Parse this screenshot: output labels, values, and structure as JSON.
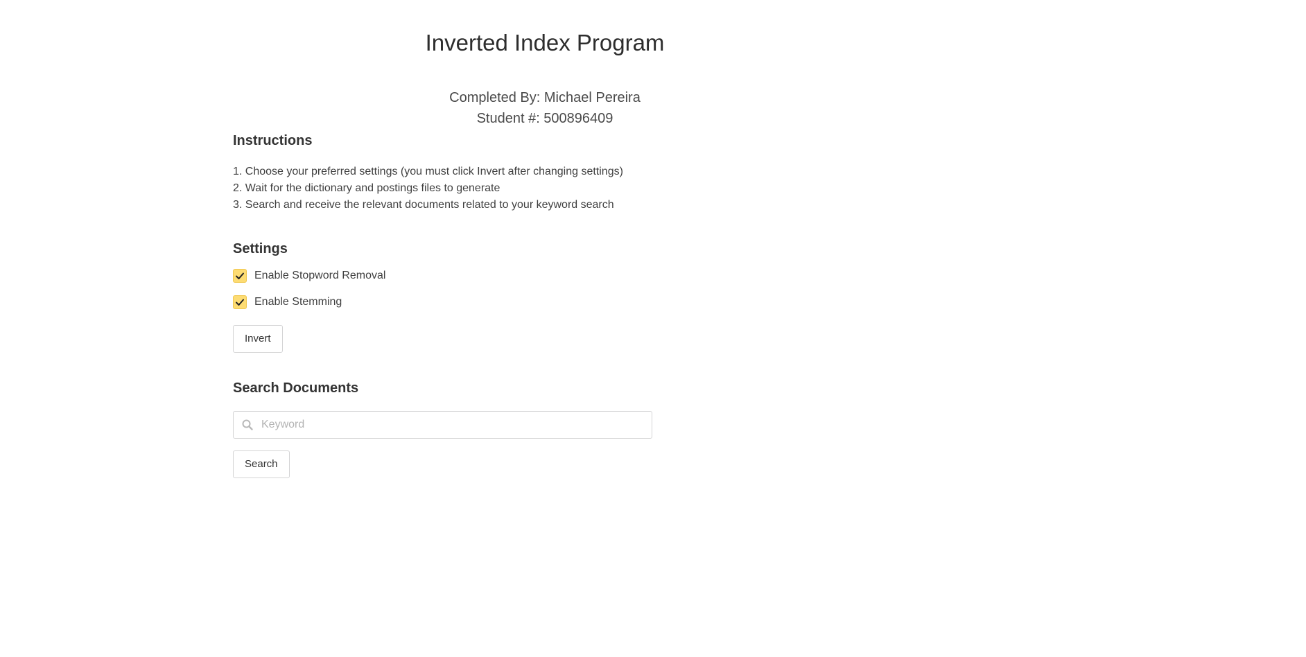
{
  "header": {
    "title": "Inverted Index Program",
    "author_line": "Completed By: Michael Pereira",
    "student_line": "Student #: 500896409"
  },
  "instructions": {
    "heading": "Instructions",
    "steps": [
      "1. Choose your preferred settings (you must click Invert after changing settings)",
      "2. Wait for the dictionary and postings files to generate",
      "3. Search and receive the relevant documents related to your keyword search"
    ]
  },
  "settings": {
    "heading": "Settings",
    "options": [
      {
        "label": "Enable Stopword Removal",
        "checked": true
      },
      {
        "label": "Enable Stemming",
        "checked": true
      }
    ],
    "invert_label": "Invert",
    "checkbox_color": "#fddc73"
  },
  "search": {
    "heading": "Search Documents",
    "placeholder": "Keyword",
    "value": "",
    "icon": "search-icon",
    "button_label": "Search"
  }
}
